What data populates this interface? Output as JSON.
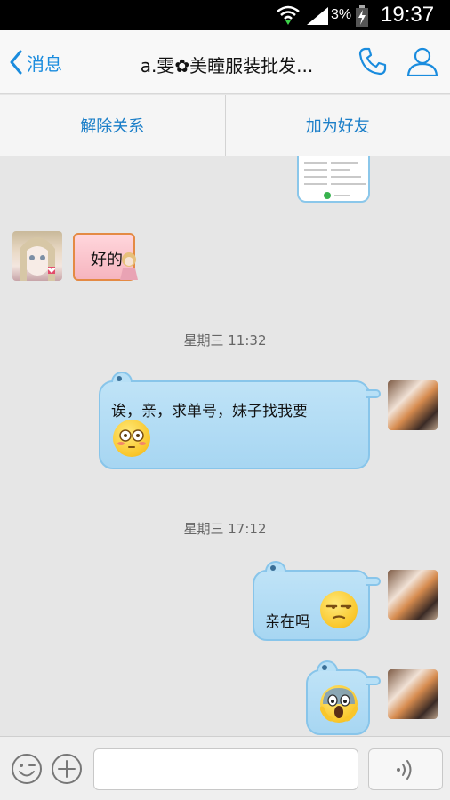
{
  "status_bar": {
    "battery_percent": "3%",
    "time": "19:37",
    "icons": [
      "wifi-icon",
      "signal-icon",
      "battery-charging-icon"
    ]
  },
  "header": {
    "back_label": "消息",
    "title": "a.雯✿美瞳服装批发...",
    "icons": [
      "chevron-left-icon",
      "phone-icon",
      "profile-icon"
    ]
  },
  "actions": {
    "remove": "解除关系",
    "add_friend": "加为好友"
  },
  "messages": {
    "reply_text": "好的",
    "time_1": "星期三 11:32",
    "msg_1": "诶，亲，求单号，妹子找我要",
    "time_2": "星期三 17:12",
    "msg_2": "亲在吗"
  },
  "input": {
    "placeholder": "",
    "icons": [
      "emoji-icon",
      "plus-icon",
      "voice-icon"
    ]
  },
  "colors": {
    "accent": "#1a8cde",
    "bubble_blue": "#a7d6f2",
    "bubble_pink": "#f6b5bf"
  }
}
